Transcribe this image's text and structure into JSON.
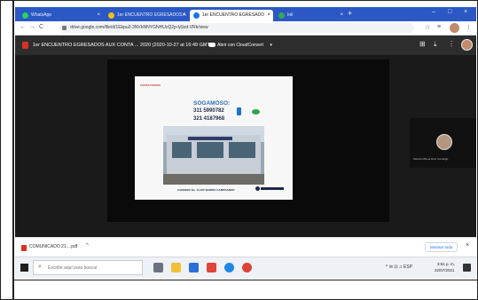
{
  "browser": {
    "tabs": [
      {
        "label": "WhatsApp",
        "color": "#25d366"
      },
      {
        "label": "1er ENCUENTRO EGRESADOS A",
        "color": "#f6bd16"
      },
      {
        "label": "1er ENCUENTRO EGRESADO",
        "color": "#1a73e8"
      },
      {
        "label": "Inil",
        "color": "#34a853"
      }
    ],
    "new_tab": "+",
    "url": "drive.google.com/file/d/1Ekpu2-3NVbNNYGNHUcQ2p-ly9zd-VRk/view",
    "window_controls": [
      "–",
      "□",
      "×"
    ]
  },
  "viewer": {
    "file_title": "1er ENCUENTRO EGRESADOS AUX CONTA ... 2020 (2020-10-27 at 16:49 GMT-7)",
    "open_with": "Abrir con CloudConvert",
    "open_with_chevron": "▾"
  },
  "slide": {
    "label": "CONTACTENOS",
    "city": "SOGAMOSO:",
    "phone_1": "311 5990782",
    "phone_2": "321 4187968",
    "address": "CARRERA No. 14-105 BARRIO CAMPOAMOR"
  },
  "participant": {
    "name": "Sandra Milena Ruiz Camargo"
  },
  "downloads": {
    "file": "COMUNICADO 21....pdf",
    "chevron": "^",
    "show_all": "Mostrar todo",
    "close": "×"
  },
  "taskbar": {
    "search_placeholder": "Escribe aquí para buscar",
    "tray": "^ ✉ ⊡ ♫ ESP",
    "time": "3:51 p. m.",
    "date": "22/07/2021"
  }
}
